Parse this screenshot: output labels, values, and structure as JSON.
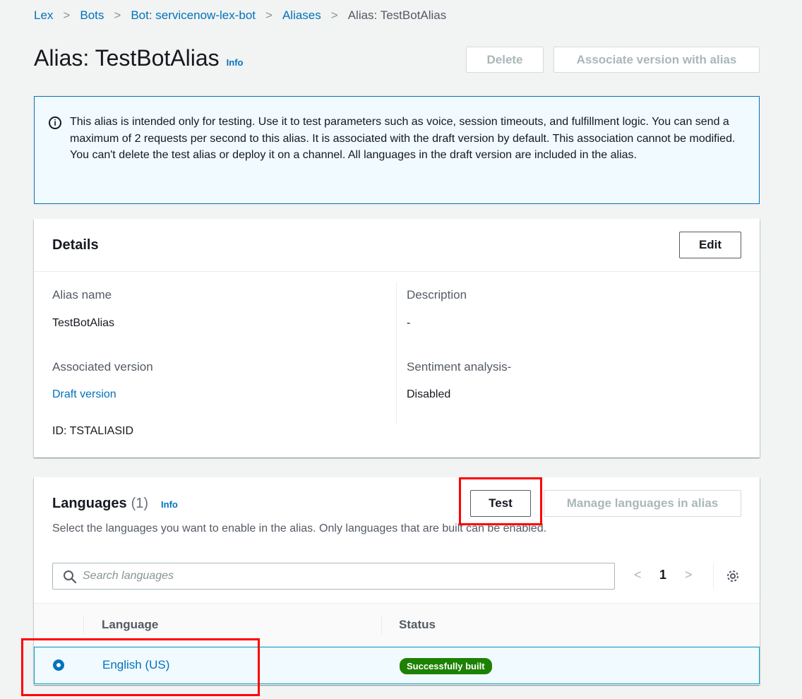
{
  "breadcrumb": {
    "items": [
      "Lex",
      "Bots",
      "Bot: servicenow-lex-bot",
      "Aliases"
    ],
    "current": "Alias: TestBotAlias"
  },
  "header": {
    "title": "Alias: TestBotAlias",
    "info": "Info",
    "delete_label": "Delete",
    "associate_label": "Associate version with alias"
  },
  "alert": {
    "icon": "info-circle-icon",
    "text": "This alias is intended only for testing. Use it to test parameters such as voice, session timeouts, and fulfillment logic. You can send a maximum of 2 requests per second to this alias. It is associated with the draft version by default. This association cannot be modified. You can't delete the test alias or deploy it on a channel. All languages in the draft version are included in the alias."
  },
  "details": {
    "title": "Details",
    "edit_label": "Edit",
    "alias_name_label": "Alias name",
    "alias_name": "TestBotAlias",
    "associated_version_label": "Associated version",
    "associated_version": "Draft version",
    "id_text": "ID: TSTALIASID",
    "description_label": "Description",
    "description": "-",
    "sentiment_label": "Sentiment analysis-",
    "sentiment": "Disabled"
  },
  "languages": {
    "title": "Languages",
    "count": "(1)",
    "info": "Info",
    "test_label": "Test",
    "manage_label": "Manage languages in alias",
    "description": "Select the languages you want to enable in the alias. Only languages that are built can be enabled.",
    "search_placeholder": "Search languages",
    "page": "1",
    "columns": [
      "Language",
      "Status"
    ],
    "rows": [
      {
        "language": "English (US)",
        "status": "Successfully built",
        "selected": true
      }
    ]
  },
  "colors": {
    "link": "#0073bb",
    "success": "#1d8102",
    "highlight_box": "#ff0000"
  }
}
